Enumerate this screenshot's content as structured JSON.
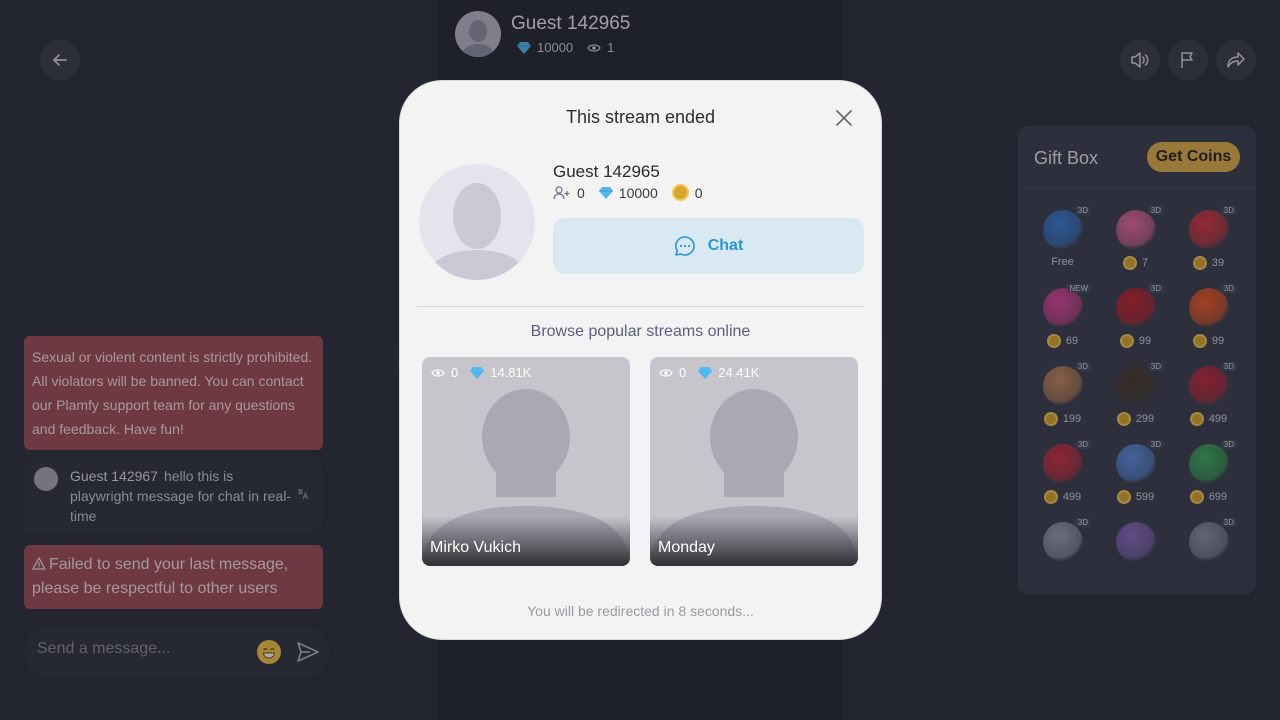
{
  "host": {
    "name": "Guest 142965",
    "diamonds": "10000",
    "viewers": "1"
  },
  "notice": "Sexual or violent content is strictly prohibited. All violators will be banned. You can contact our Plamfy support team for any questions and feedback. Have fun!",
  "chat": {
    "message": {
      "author": "Guest 142967",
      "text": "hello this is playwright message for chat in real-time"
    },
    "error": "Failed to send your last message, please be respectful to other users",
    "input_placeholder": "Send a message..."
  },
  "giftbox": {
    "title": "Gift Box",
    "get_coins": "Get Coins",
    "gifts": [
      {
        "tag": "3D",
        "icon": "hi-bird-gift",
        "price": "Free",
        "coin": false,
        "color": "#3a7bd5"
      },
      {
        "tag": "3D",
        "icon": "follow-me-heart-gift",
        "price": "7",
        "coin": true,
        "color": "#e86a9a"
      },
      {
        "tag": "3D",
        "icon": "strawberry-gift",
        "price": "39",
        "coin": true,
        "color": "#d9363e"
      },
      {
        "tag": "NEW",
        "icon": "lips-gift",
        "price": "69",
        "coin": true,
        "color": "#e0459a"
      },
      {
        "tag": "3D",
        "icon": "rose-gift",
        "price": "99",
        "coin": true,
        "color": "#c4232d"
      },
      {
        "tag": "3D",
        "icon": "fire-gift",
        "price": "99",
        "coin": true,
        "color": "#f05a24"
      },
      {
        "tag": "3D",
        "icon": "teddy-bear-gift",
        "price": "199",
        "coin": true,
        "color": "#c8875a"
      },
      {
        "tag": "3D",
        "icon": "champagne-gift",
        "price": "299",
        "coin": true,
        "color": "#4a3a2a"
      },
      {
        "tag": "3D",
        "icon": "heart-box-gift",
        "price": "499",
        "coin": true,
        "color": "#c0283a"
      },
      {
        "tag": "3D",
        "icon": "heart-lock-gift",
        "price": "499",
        "coin": true,
        "color": "#d12e3e"
      },
      {
        "tag": "3D",
        "icon": "balloon-hearts-gift",
        "price": "599",
        "coin": true,
        "color": "#5b8fe0"
      },
      {
        "tag": "3D",
        "icon": "money-gift",
        "price": "699",
        "coin": true,
        "color": "#3cae5a"
      },
      {
        "tag": "3D",
        "icon": "ring-gift",
        "price": "",
        "coin": false,
        "color": "#9aa0b0"
      },
      {
        "tag": "",
        "icon": "dress-gift",
        "price": "",
        "coin": false,
        "color": "#8a6ac0"
      },
      {
        "tag": "3D",
        "icon": "shell-gift",
        "price": "",
        "coin": false,
        "color": "#8d93a0"
      }
    ]
  },
  "modal": {
    "title": "This stream ended",
    "user": {
      "name": "Guest 142965",
      "followers": "0",
      "diamonds": "10000",
      "coins": "0"
    },
    "chat_label": "Chat",
    "browse_title": "Browse popular streams online",
    "streams": [
      {
        "name": "Mirko Vukich",
        "viewers": "0",
        "diamonds": "14.81K"
      },
      {
        "name": "Monday",
        "viewers": "0",
        "diamonds": "24.41K"
      }
    ],
    "redirect_text": "You will be redirected in 8 seconds..."
  },
  "colors": {
    "accent": "#2a96d6",
    "coin": "#d9a52a",
    "alert": "#9e4d57",
    "get_coins": "#e0b04b"
  }
}
